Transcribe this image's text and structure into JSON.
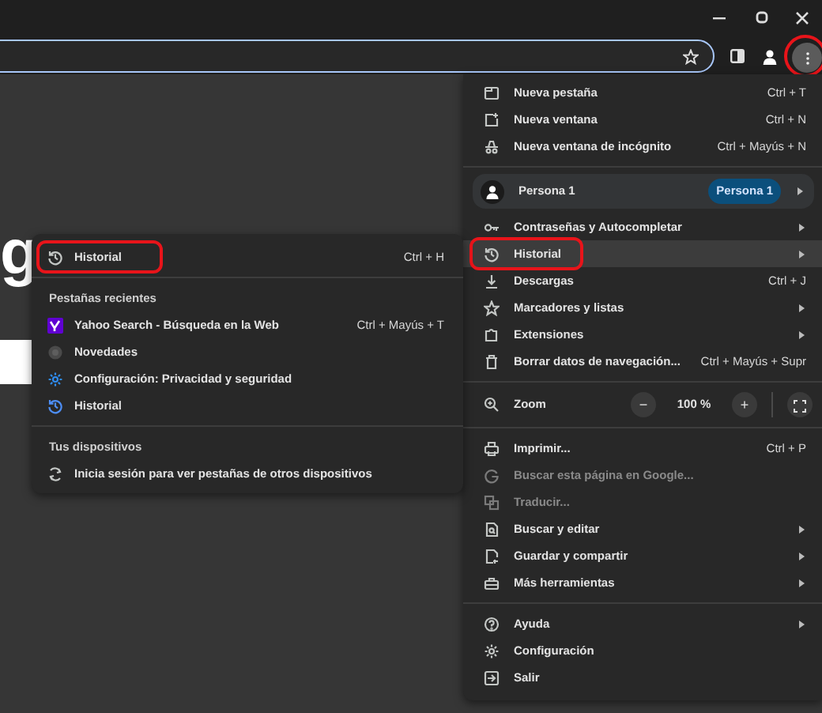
{
  "background": {
    "logo_fragment": "g"
  },
  "toolbar": {
    "menu_button": {
      "annotated": true
    }
  },
  "menu": {
    "sections": [
      [
        {
          "kind": "item",
          "label": "Nueva pestaña",
          "shortcut": "Ctrl + T",
          "has_submenu": false,
          "disabled": false,
          "highlighted": false,
          "annotated": false
        },
        {
          "kind": "item",
          "label": "Nueva ventana",
          "shortcut": "Ctrl + N",
          "has_submenu": false,
          "disabled": false,
          "highlighted": false,
          "annotated": false
        },
        {
          "kind": "item",
          "label": "Nueva ventana de incógnito",
          "shortcut": "Ctrl + Mayús + N",
          "has_submenu": false,
          "disabled": false,
          "highlighted": false,
          "annotated": false
        }
      ],
      [
        {
          "kind": "profile",
          "label": "Persona 1",
          "badge": "Persona 1",
          "has_submenu": true
        },
        {
          "kind": "item",
          "label": "Contraseñas y Autocompletar",
          "has_submenu": true,
          "disabled": false,
          "highlighted": false,
          "annotated": false
        },
        {
          "kind": "item",
          "label": "Historial",
          "has_submenu": true,
          "disabled": false,
          "highlighted": true,
          "annotated": true
        },
        {
          "kind": "item",
          "label": "Descargas",
          "shortcut": "Ctrl + J",
          "has_submenu": false,
          "disabled": false,
          "highlighted": false,
          "annotated": false
        },
        {
          "kind": "item",
          "label": "Marcadores y listas",
          "has_submenu": true,
          "disabled": false,
          "highlighted": false,
          "annotated": false
        },
        {
          "kind": "item",
          "label": "Extensiones",
          "has_submenu": true,
          "disabled": false,
          "highlighted": false,
          "annotated": false
        },
        {
          "kind": "item",
          "label": "Borrar datos de navegación...",
          "shortcut": "Ctrl + Mayús + Supr",
          "has_submenu": false,
          "disabled": false,
          "highlighted": false,
          "annotated": false
        }
      ],
      [
        {
          "kind": "zoom",
          "label": "Zoom",
          "minus": "−",
          "value": "100 %",
          "plus": "+"
        }
      ],
      [
        {
          "kind": "item",
          "label": "Imprimir...",
          "shortcut": "Ctrl + P",
          "has_submenu": false,
          "disabled": false,
          "highlighted": false,
          "annotated": false
        },
        {
          "kind": "item",
          "label": "Buscar esta página en Google...",
          "has_submenu": false,
          "disabled": true,
          "highlighted": false,
          "annotated": false
        },
        {
          "kind": "item",
          "label": "Traducir...",
          "has_submenu": false,
          "disabled": true,
          "highlighted": false,
          "annotated": false
        },
        {
          "kind": "item",
          "label": "Buscar y editar",
          "has_submenu": true,
          "disabled": false,
          "highlighted": false,
          "annotated": false
        },
        {
          "kind": "item",
          "label": "Guardar y compartir",
          "has_submenu": true,
          "disabled": false,
          "highlighted": false,
          "annotated": false
        },
        {
          "kind": "item",
          "label": "Más herramientas",
          "has_submenu": true,
          "disabled": false,
          "highlighted": false,
          "annotated": false
        }
      ],
      [
        {
          "kind": "item",
          "label": "Ayuda",
          "has_submenu": true,
          "disabled": false,
          "highlighted": false,
          "annotated": false
        },
        {
          "kind": "item",
          "label": "Configuración",
          "has_submenu": false,
          "disabled": false,
          "highlighted": false,
          "annotated": false
        },
        {
          "kind": "item",
          "label": "Salir",
          "has_submenu": false,
          "disabled": false,
          "highlighted": false,
          "annotated": false
        }
      ]
    ]
  },
  "history_submenu": {
    "sections": [
      [
        {
          "kind": "item",
          "label": "Historial",
          "shortcut": "Ctrl + H",
          "disabled": false,
          "annotated": true
        }
      ],
      [
        {
          "kind": "header",
          "label": "Pestañas recientes"
        },
        {
          "kind": "item",
          "label": "Yahoo Search - Búsqueda en la Web",
          "shortcut": "Ctrl + Mayús + T",
          "disabled": false,
          "annotated": false
        },
        {
          "kind": "item",
          "label": "Novedades",
          "disabled": false,
          "annotated": false
        },
        {
          "kind": "item",
          "label": "Configuración: Privacidad y seguridad",
          "disabled": false,
          "annotated": false
        },
        {
          "kind": "item",
          "label": "Historial",
          "disabled": false,
          "annotated": false
        }
      ],
      [
        {
          "kind": "header",
          "label": "Tus dispositivos"
        },
        {
          "kind": "item",
          "label": "Inicia sesión para ver pestañas de otros dispositivos",
          "disabled": false,
          "annotated": false
        }
      ]
    ]
  }
}
